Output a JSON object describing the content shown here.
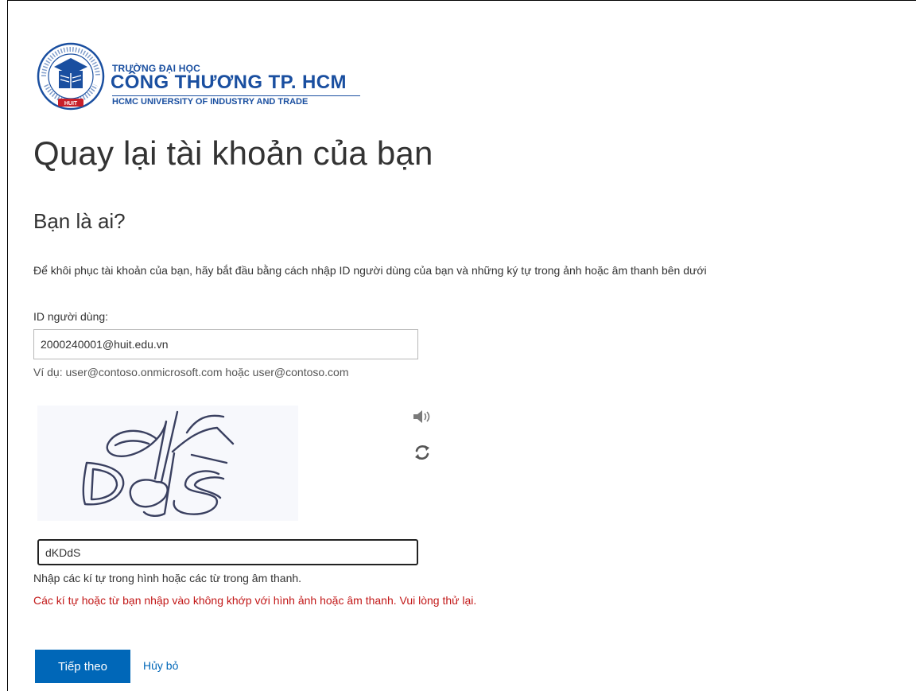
{
  "logo": {
    "line1": "TRƯỜNG ĐẠI HỌC",
    "line2": "CÔNG THƯƠNG TP. HCM",
    "line3": "HCMC UNIVERSITY OF INDUSTRY AND TRADE",
    "emblem_ring_text": "TRƯỜNG ĐẠI HỌC CÔNG THƯƠNG THÀNH PHỐ HỒ CHÍ MINH",
    "emblem_badge": "HUIT",
    "brand_color": "#1a4fa0",
    "accent_color": "#c8202a"
  },
  "page": {
    "title": "Quay lại tài khoản của bạn",
    "subtitle": "Bạn là ai?",
    "description": "Để khôi phục tài khoản của bạn, hãy bắt đầu bằng cách nhập ID người dùng của bạn và những ký tự trong ảnh hoặc âm thanh bên dưới"
  },
  "user_id": {
    "label": "ID người dùng:",
    "value": "2000240001@huit.edu.vn",
    "example": "Ví dụ: user@contoso.onmicrosoft.com hoặc user@contoso.com"
  },
  "captcha": {
    "image_text": "dKDdS",
    "audio_icon": "speaker-icon",
    "refresh_icon": "refresh-icon",
    "input_value": "dKDdS",
    "hint": "Nhập các kí tự trong hình hoặc các từ trong âm thanh.",
    "error": "Các kí tự hoặc từ bạn nhập vào không khớp với hình ảnh hoặc âm thanh. Vui lòng thử lại.",
    "error_color": "#c21818"
  },
  "actions": {
    "next_label": "Tiếp theo",
    "cancel_label": "Hủy bỏ",
    "primary_color": "#0067b8"
  }
}
